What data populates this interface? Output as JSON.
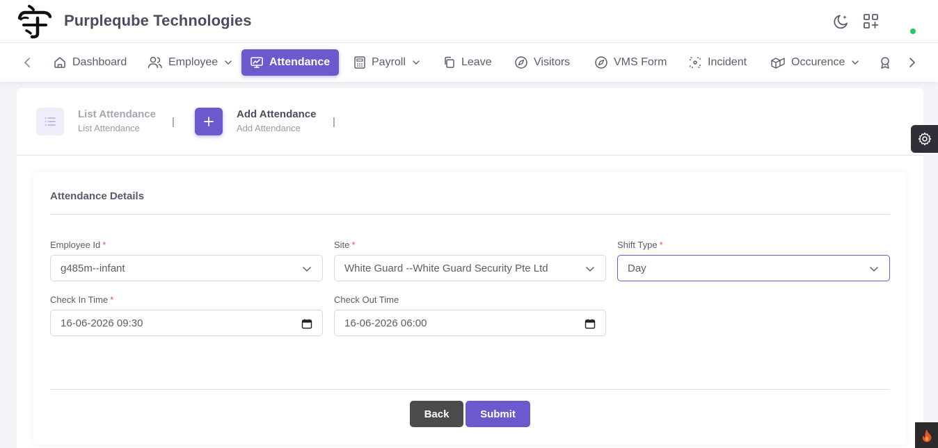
{
  "header": {
    "company_name": "Purpleqube Technologies",
    "icons": [
      "moon-icon",
      "apps-add-icon"
    ],
    "status_color": "#28c76f"
  },
  "nav": {
    "items": [
      {
        "label": "Dashboard",
        "icon": "home-icon"
      },
      {
        "label": "Employee",
        "icon": "users-icon",
        "dropdown": true
      },
      {
        "label": "Attendance",
        "icon": "monitor-chart-icon",
        "active": true
      },
      {
        "label": "Payroll",
        "icon": "calculator-icon",
        "dropdown": true
      },
      {
        "label": "Leave",
        "icon": "copy-icon"
      },
      {
        "label": "Visitors",
        "icon": "compass-icon"
      },
      {
        "label": "VMS Form",
        "icon": "compass-icon"
      },
      {
        "label": "Incident",
        "icon": "focus-icon"
      },
      {
        "label": "Occurence",
        "icon": "boxes-icon",
        "dropdown": true
      }
    ],
    "accent": "#6a5acd"
  },
  "steps": [
    {
      "title": "List Attendance",
      "subtitle": "List Attendance"
    },
    {
      "title": "Add Attendance",
      "subtitle": "Add Attendance"
    }
  ],
  "form": {
    "section_title": "Attendance Details",
    "employee_id": {
      "label": "Employee Id",
      "value": "g485m--infant"
    },
    "site": {
      "label": "Site",
      "value": "White Guard --White Guard Security Pte Ltd"
    },
    "shift_type": {
      "label": "Shift Type",
      "value": "Day"
    },
    "check_in": {
      "label": "Check In Time",
      "value": "16-06-2026 09:30"
    },
    "check_out": {
      "label": "Check Out Time",
      "value": "16-06-2026 06:00"
    },
    "back_label": "Back",
    "submit_label": "Submit",
    "required_marker": "*"
  }
}
